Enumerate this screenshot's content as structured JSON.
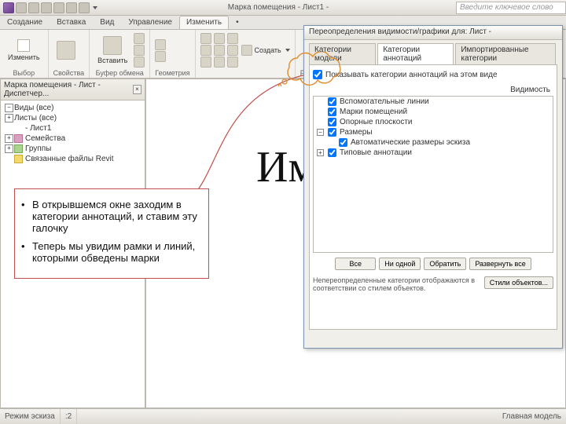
{
  "titlebar": {
    "title": "Марка помещения - Лист1 -",
    "search_placeholder": "Введите ключевое слово"
  },
  "ribbon": {
    "tabs": [
      "Создание",
      "Вставка",
      "Вид",
      "Управление",
      "Изменить"
    ],
    "active_tab_index": 4,
    "groups": {
      "g0": {
        "btn": "Изменить",
        "label": "Выбор"
      },
      "g1": {
        "label": "Свойства"
      },
      "g2": {
        "paste": "Вставить",
        "label": "Буфер обмена"
      },
      "g3": {
        "label": "Геометрия"
      },
      "g4": {
        "create": "Создать",
        "label": ""
      },
      "g5": {
        "label": "Редакти"
      }
    }
  },
  "dialog": {
    "title": "Переопределения видимости/графики для: Лист -",
    "tabs": [
      "Категории модели",
      "Категории аннотаций",
      "Импортированные категории"
    ],
    "active_tab_index": 1,
    "show_checkbox_label": "Показывать категории аннотаций на этом виде",
    "vis_header": "Видимость",
    "categories": [
      {
        "l": "Вспомогательные линии",
        "c": true
      },
      {
        "l": "Марки помещений",
        "c": true
      },
      {
        "l": "Опорные плоскости",
        "c": true
      },
      {
        "l": "Размеры",
        "c": true,
        "expand": true
      },
      {
        "l": "Автоматические размеры эскиза",
        "c": true,
        "sub": true
      },
      {
        "l": "Типовые аннотации",
        "c": true
      }
    ],
    "buttons": {
      "all": "Все",
      "none": "Ни одной",
      "invert": "Обратить",
      "expand": "Развернуть все",
      "styles": "Стили объектов..."
    },
    "note": "Непереопределенные категории отображаются в соответствии со стилем объектов."
  },
  "browser": {
    "title": "Марка помещения - Лист - Диспетчер...",
    "items": [
      {
        "l": "Виды (все)",
        "lvl": 1,
        "minus": true,
        "ic": ""
      },
      {
        "l": "Листы (все)",
        "lvl": 1,
        "ic": ""
      },
      {
        "l": " - Лист1",
        "lvl": 2,
        "leaf": true,
        "ic": ""
      },
      {
        "l": "Семейства",
        "lvl": 1,
        "ic": "r"
      },
      {
        "l": "Группы",
        "lvl": 1,
        "ic": "g"
      },
      {
        "l": "Связанные файлы Revit",
        "lvl": 1,
        "leaf": true,
        "ic": "y"
      }
    ]
  },
  "canvas": {
    "bigtext": "Имя"
  },
  "instructions": {
    "b1": "В открывшемся окне заходим в категории аннотаций, и ставим эту галочку",
    "b2": "Теперь мы увидим рамки и линий, которыми обведены марки"
  },
  "statusbar": {
    "left": "Режим эскиза",
    "zoom_indicator": ":2",
    "right": "Главная модель"
  }
}
